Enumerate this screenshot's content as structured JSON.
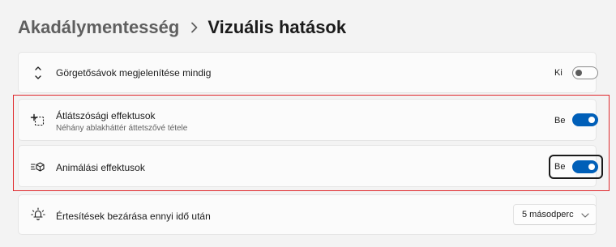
{
  "breadcrumb": {
    "parent": "Akadálymentesség",
    "current": "Vizuális hatások"
  },
  "settings": {
    "scrollbars": {
      "title": "Görgetősávok megjelenítése mindig",
      "state_label": "Ki",
      "enabled": false,
      "icon": "scrollbar-arrows-icon"
    },
    "transparency": {
      "title": "Átlátszósági effektusok",
      "subtitle": "Néhány ablakháttér áttetszővé tétele",
      "state_label": "Be",
      "enabled": true,
      "icon": "transparency-icon"
    },
    "animation": {
      "title": "Animálási effektusok",
      "state_label": "Be",
      "enabled": true,
      "focused": true,
      "icon": "animation-icon"
    },
    "notifications": {
      "title": "Értesítések bezárása ennyi idő után",
      "selected": "5 másodperc",
      "icon": "notification-bell-icon"
    }
  },
  "colors": {
    "accent": "#005fb8",
    "highlight": "#e0282c",
    "background": "#f3f3f3",
    "card": "#fbfbfb"
  }
}
